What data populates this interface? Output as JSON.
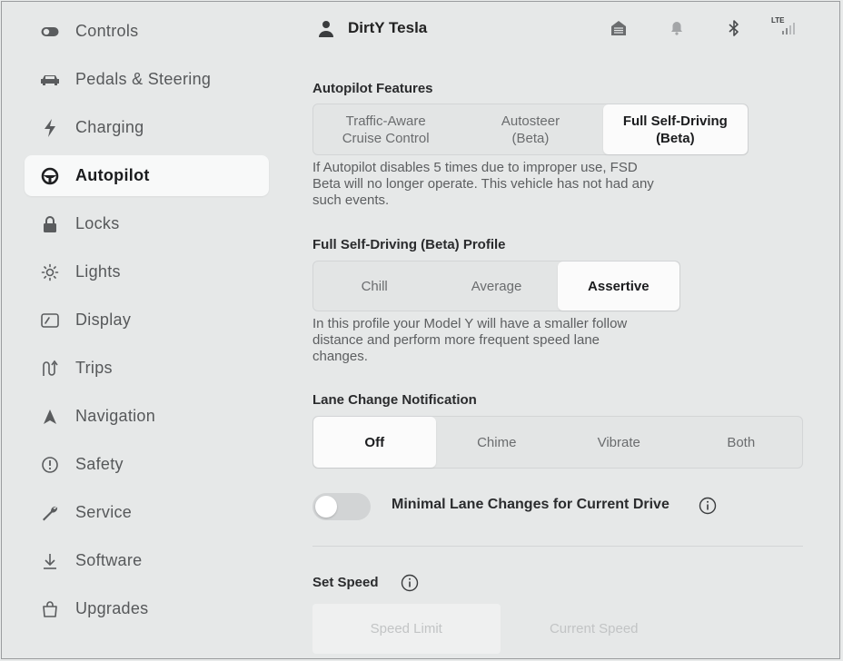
{
  "sidebar": {
    "items": [
      {
        "label": "Controls",
        "icon": "toggle-icon"
      },
      {
        "label": "Pedals & Steering",
        "icon": "car-icon"
      },
      {
        "label": "Charging",
        "icon": "lightning-icon"
      },
      {
        "label": "Autopilot",
        "icon": "steering-wheel-icon",
        "active": true
      },
      {
        "label": "Locks",
        "icon": "lock-icon"
      },
      {
        "label": "Lights",
        "icon": "light-icon"
      },
      {
        "label": "Display",
        "icon": "display-icon"
      },
      {
        "label": "Trips",
        "icon": "trips-icon"
      },
      {
        "label": "Navigation",
        "icon": "navigation-icon"
      },
      {
        "label": "Safety",
        "icon": "safety-icon"
      },
      {
        "label": "Service",
        "icon": "wrench-icon"
      },
      {
        "label": "Software",
        "icon": "download-icon"
      },
      {
        "label": "Upgrades",
        "icon": "bag-icon"
      }
    ]
  },
  "header": {
    "profile_name": "DirtY Tesla",
    "signal_label": "LTE"
  },
  "autopilot_features": {
    "title": "Autopilot Features",
    "options": [
      {
        "line1": "Traffic-Aware",
        "line2": "Cruise Control"
      },
      {
        "line1": "Autosteer",
        "line2": "(Beta)"
      },
      {
        "line1": "Full Self-Driving",
        "line2": "(Beta)"
      }
    ],
    "selected": 2,
    "description": "If Autopilot disables 5 times due to improper use, FSD Beta will no longer operate. This vehicle has not had any such events."
  },
  "fsd_profile": {
    "title": "Full Self-Driving (Beta) Profile",
    "options": [
      "Chill",
      "Average",
      "Assertive"
    ],
    "selected": 2,
    "description": "In this profile your Model Y will have a smaller follow distance and perform more frequent speed lane changes."
  },
  "lane_change": {
    "title": "Lane Change Notification",
    "options": [
      "Off",
      "Chime",
      "Vibrate",
      "Both"
    ],
    "selected": 0
  },
  "minimal_lane_changes": {
    "label": "Minimal Lane Changes for Current Drive",
    "enabled": false
  },
  "set_speed": {
    "title": "Set Speed",
    "options": [
      "Speed Limit",
      "Current Speed"
    ],
    "selected": 0
  },
  "colors": {
    "background": "#e6e8e8",
    "selected": "#fbfbfb",
    "text_primary": "#1b1c1e",
    "text_secondary": "#5c5e60"
  }
}
